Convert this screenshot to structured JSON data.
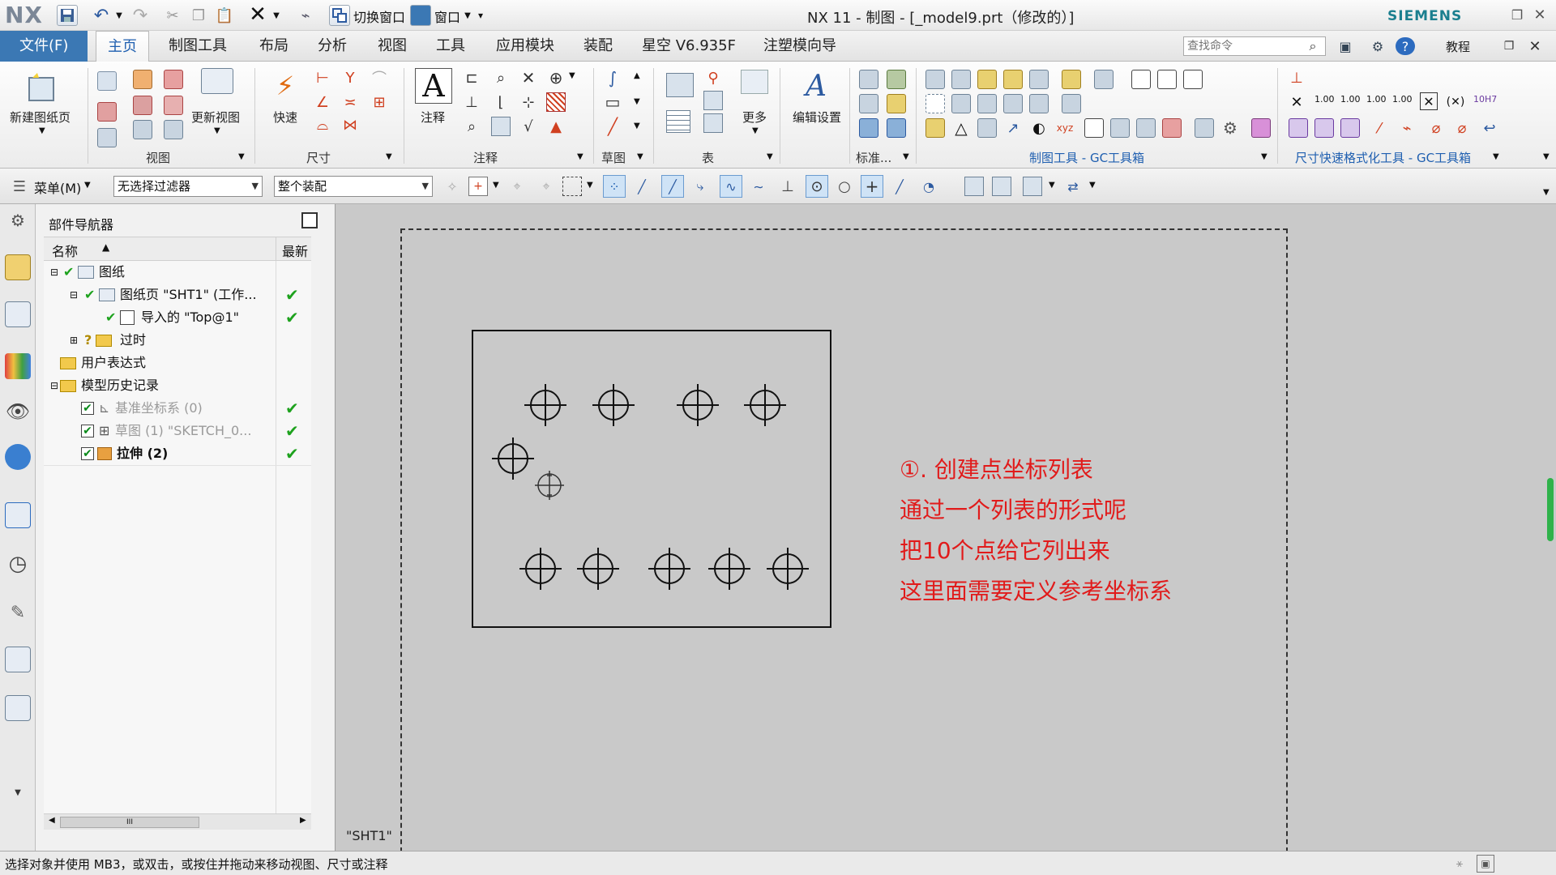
{
  "titlebar": {
    "logo": "NX",
    "title": "NX 11 - 制图 - [_model9.prt（修改的）]",
    "switch_window": "切换窗口",
    "window_menu": "窗口",
    "brand": "SIEMENS"
  },
  "tabs": {
    "file": "文件(F)",
    "items": [
      "主页",
      "制图工具",
      "布局",
      "分析",
      "视图",
      "工具",
      "应用模块",
      "装配",
      "星空 V6.935F",
      "注塑模向导"
    ],
    "search_placeholder": "查找命令",
    "help_label": "教程"
  },
  "ribbon": {
    "new_sheet": "新建图纸页",
    "update_view": "更新视图",
    "quick": "快速",
    "annotation": "注释",
    "more": "更多",
    "edit_settings": "编辑设置",
    "groups": {
      "view": "视图",
      "dimension": "尺寸",
      "annotation": "注释",
      "sketch": "草图",
      "table": "表",
      "standard": "标准...",
      "drafting_tools": "制图工具 - GC工具箱",
      "dim_format": "尺寸快速格式化工具 - GC工具箱"
    },
    "dim_icon_texts": [
      "1.00",
      "1.00",
      "1.00",
      "1.00",
      "10H7"
    ]
  },
  "selection_bar": {
    "menu": "菜单(M)",
    "filter": "无选择过滤器",
    "scope": "整个装配"
  },
  "navigator": {
    "title": "部件导航器",
    "col_name": "名称",
    "col_latest": "最新",
    "rows": [
      {
        "label": "图纸",
        "latest": ""
      },
      {
        "label": "图纸页 \"SHT1\" (工作...",
        "latest": "✔"
      },
      {
        "label": "导入的 \"Top@1\"",
        "latest": "✔"
      },
      {
        "label": "过时",
        "latest": ""
      },
      {
        "label": "用户表达式",
        "latest": ""
      },
      {
        "label": "模型历史记录",
        "latest": ""
      },
      {
        "label": "基准坐标系 (0)",
        "latest": "✔"
      },
      {
        "label": "草图 (1) \"SKETCH_0...",
        "latest": "✔"
      },
      {
        "label": "拉伸 (2)",
        "latest": "✔"
      }
    ],
    "scroll_grip": "III"
  },
  "drawing": {
    "sheet_name": "\"SHT1\""
  },
  "annotation_text": {
    "line1": "①. 创建点坐标列表",
    "line2": "通过一个列表的形式呢",
    "line3": "把10个点给它列出来",
    "line4": "这里面需要定义参考坐标系"
  },
  "status": {
    "message": "选择对象并使用 MB3，或双击，或按住并拖动来移动视图、尺寸或注释"
  },
  "colors": {
    "accent": "#3b78b4",
    "annotation_red": "#e11b1b",
    "check_green": "#1ea21e",
    "canvas_gray": "#c9c9c9"
  }
}
